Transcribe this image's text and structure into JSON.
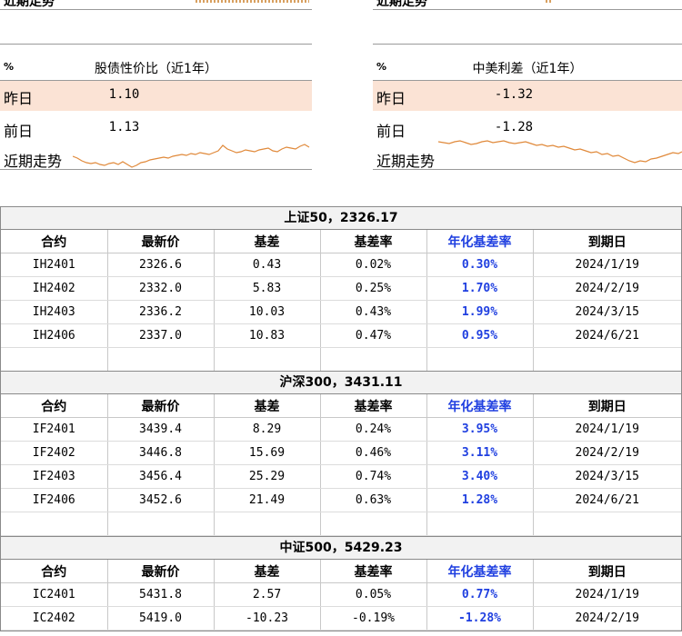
{
  "top_panels": {
    "left": {
      "cut_label": "近期走势",
      "pct": "%",
      "title": "股债性价比（近1年）",
      "yesterday_label": "昨日",
      "yesterday_value": "1.10",
      "prev_label": "前日",
      "prev_value": "1.13",
      "trend_label": "近期走势"
    },
    "right": {
      "cut_label": "近期走势",
      "pct": "%",
      "title": "中美利差（近1年）",
      "yesterday_label": "昨日",
      "yesterday_value": "-1.32",
      "prev_label": "前日",
      "prev_value": "-1.28",
      "trend_label": "近期走势"
    },
    "colors": {
      "highlight": "#fbe3d5",
      "sparkline": "#e0893a"
    }
  },
  "columns": [
    "合约",
    "最新价",
    "基差",
    "基差率",
    "年化基差率",
    "到期日"
  ],
  "sections": [
    {
      "title": "上证50，2326.17",
      "rows": [
        [
          "IH2401",
          "2326.6",
          "0.43",
          "0.02%",
          "0.30%",
          "2024/1/19"
        ],
        [
          "IH2402",
          "2332.0",
          "5.83",
          "0.25%",
          "1.70%",
          "2024/2/19"
        ],
        [
          "IH2403",
          "2336.2",
          "10.03",
          "0.43%",
          "1.99%",
          "2024/3/15"
        ],
        [
          "IH2406",
          "2337.0",
          "10.83",
          "0.47%",
          "0.95%",
          "2024/6/21"
        ]
      ]
    },
    {
      "title": "沪深300，3431.11",
      "rows": [
        [
          "IF2401",
          "3439.4",
          "8.29",
          "0.24%",
          "3.95%",
          "2024/1/19"
        ],
        [
          "IF2402",
          "3446.8",
          "15.69",
          "0.46%",
          "3.11%",
          "2024/2/19"
        ],
        [
          "IF2403",
          "3456.4",
          "25.29",
          "0.74%",
          "3.40%",
          "2024/3/15"
        ],
        [
          "IF2406",
          "3452.6",
          "21.49",
          "0.63%",
          "1.28%",
          "2024/6/21"
        ]
      ]
    },
    {
      "title": "中证500，5429.23",
      "rows": [
        [
          "IC2401",
          "5431.8",
          "2.57",
          "0.05%",
          "0.77%",
          "2024/1/19"
        ],
        [
          "IC2402",
          "5419.0",
          "-10.23",
          "-0.19%",
          "-1.28%",
          "2024/2/19"
        ]
      ]
    }
  ]
}
